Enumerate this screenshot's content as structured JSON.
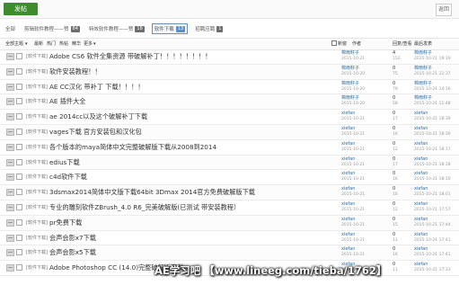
{
  "header": {
    "post_button": "发帖",
    "back_button": "返回"
  },
  "tabs": [
    {
      "label": "全部",
      "count": ""
    },
    {
      "label": "剪辑软件教程——赞",
      "count": "84"
    },
    {
      "label": "特效软件教程——赞",
      "count": "18"
    },
    {
      "label": "软件下载",
      "count": "13"
    },
    {
      "label": "招聘应聘",
      "count": "1"
    }
  ],
  "sortbar": {
    "all_topics": "全部主题",
    "latest": "最新",
    "hot": "热门",
    "popular": "热帖",
    "digest": "精华",
    "more": "更多",
    "new_window": "新窗",
    "author": "作者",
    "replies_views": "回复/查看",
    "last_post": "最后发表"
  },
  "rows": [
    {
      "cat": "[软件下载]",
      "title": "Adobe CS6 软件全集资源 带破解补丁！！！！！！！！",
      "author": "棉雨籽子",
      "time": "2015-10-21",
      "replies": "4",
      "views": "152",
      "last": "棉雨籽子",
      "ltime": "2015-10-21 19:19"
    },
    {
      "cat": "[软件下载]",
      "title": "软件安装教程！！",
      "author": "棉雨籽子",
      "time": "2015-10-20",
      "replies": "0",
      "views": "75",
      "last": "棉雨籽子",
      "ltime": "2015-10-21 21:37"
    },
    {
      "cat": "[软件下载]",
      "title": "AE CC汉化 带补丁 下载！！！！",
      "author": "棉雨籽子",
      "time": "2015-10-20",
      "replies": "0",
      "views": "79",
      "last": "棉雨籽子",
      "ltime": "2015-10-21 14:16"
    },
    {
      "cat": "[软件下载]",
      "title": "AE 插件大全",
      "author": "棉雨籽子",
      "time": "2015-10-20",
      "replies": "0",
      "views": "58",
      "last": "棉雨籽子",
      "ltime": "2015-10-21 11:48"
    },
    {
      "cat": "[软件下载]",
      "title": "ae 2014cc以及这个破解补丁下载",
      "author": "xiefan",
      "time": "2015-10-21",
      "replies": "0",
      "views": "17",
      "last": "xiefan",
      "ltime": "2015-10-21 18:39"
    },
    {
      "cat": "[软件下载]",
      "title": "vages下载 官方安装包和汉化包",
      "author": "xiefan",
      "time": "2015-10-21",
      "replies": "0",
      "views": "16",
      "last": "xiefan",
      "ltime": "2015-10-21 18:30"
    },
    {
      "cat": "[软件下载]",
      "title": "各个版本的maya简体中文完整破解版下载从2008到2014",
      "author": "xiefan",
      "time": "2015-10-21",
      "replies": "0",
      "views": "12",
      "last": "xiefan",
      "ltime": "2015-10-21 18:17"
    },
    {
      "cat": "[软件下载]",
      "title": "edius下载",
      "author": "xiefan",
      "time": "2015-10-21",
      "replies": "0",
      "views": "17",
      "last": "xiefan",
      "ltime": "2015-10-21 18:18"
    },
    {
      "cat": "[软件下载]",
      "title": "c4d软件下载",
      "author": "xiefan",
      "time": "2015-10-21",
      "replies": "0",
      "views": "16",
      "last": "xiefan",
      "ltime": "2015-10-21 18:10"
    },
    {
      "cat": "[软件下载]",
      "title": "3dsmax2014简体中文版下载64bit 3Dmax 2014官方免费破解版下载",
      "author": "xiefan",
      "time": "2015-10-21",
      "replies": "0",
      "views": "16",
      "last": "xiefan",
      "ltime": "2015-10-21 18:01"
    },
    {
      "cat": "[软件下载]",
      "title": "专业的雕刻软件ZBrush_4.0 R6_完美破解版(已测试 带安装教程）",
      "author": "xiefan",
      "time": "2015-10-21",
      "replies": "0",
      "views": "12",
      "last": "xiefan",
      "ltime": "2015-10-21 17:57"
    },
    {
      "cat": "[软件下载]",
      "title": "pr免费下载",
      "author": "xiefan",
      "time": "2015-10-21",
      "replies": "0",
      "views": "15",
      "last": "xiefan",
      "ltime": "2015-10-21 17:44"
    },
    {
      "cat": "[软件下载]",
      "title": "会声会影x7下载",
      "author": "xiefan",
      "time": "2015-10-21",
      "replies": "0",
      "views": "11",
      "last": "xiefan",
      "ltime": "2015-10-21 17:41"
    },
    {
      "cat": "[软件下载]",
      "title": "会声会影x5下载",
      "author": "xiefan",
      "time": "2015-10-21",
      "replies": "0",
      "views": "16",
      "last": "xiefan",
      "ltime": "2015-10-21 17:41"
    },
    {
      "cat": "[软件下载]",
      "title": "Adobe Photoshop CC (14.0)完整破解版下载",
      "author": "xiefan",
      "time": "2015-10-21",
      "replies": "0",
      "views": "11",
      "last": "xiefan",
      "ltime": "2015-10-21 17:33"
    }
  ],
  "watermark": "AE学习吧  【www.lineeg.com/tieba/1762】"
}
